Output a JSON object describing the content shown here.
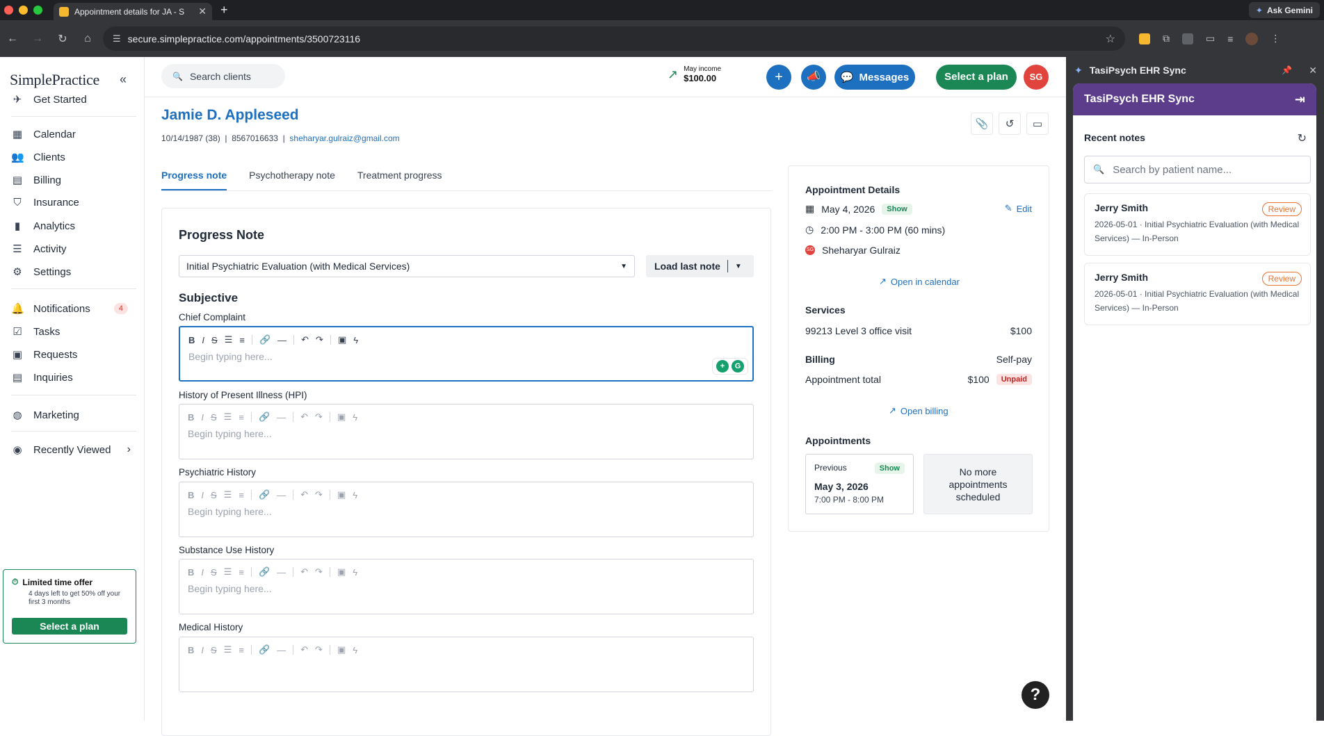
{
  "browser": {
    "tab_title": "Appointment details for JA - S",
    "url": "secure.simplepractice.com/appointments/3500723116",
    "gemini_label": "Ask Gemini"
  },
  "sidebar": {
    "logo": "SimplePractice",
    "items": [
      {
        "label": "Get Started",
        "icon": "rocket-icon"
      },
      {
        "label": "Calendar",
        "icon": "calendar-icon"
      },
      {
        "label": "Clients",
        "icon": "users-icon"
      },
      {
        "label": "Billing",
        "icon": "billing-icon"
      },
      {
        "label": "Insurance",
        "icon": "shield-icon"
      },
      {
        "label": "Analytics",
        "icon": "chart-icon"
      },
      {
        "label": "Activity",
        "icon": "list-icon"
      },
      {
        "label": "Settings",
        "icon": "gear-icon"
      },
      {
        "label": "Notifications",
        "icon": "bell-icon",
        "count": "4"
      },
      {
        "label": "Tasks",
        "icon": "tasks-icon"
      },
      {
        "label": "Requests",
        "icon": "requests-icon"
      },
      {
        "label": "Inquiries",
        "icon": "inquiries-icon"
      },
      {
        "label": "Marketing",
        "icon": "globe-icon"
      },
      {
        "label": "Recently Viewed",
        "icon": "eye-icon"
      }
    ],
    "offer": {
      "title": "Limited time offer",
      "desc": "4 days left to get 50% off your first 3 months",
      "button": "Select a plan"
    }
  },
  "header": {
    "search_placeholder": "Search clients",
    "income_label": "May income",
    "income_value": "$100.00",
    "messages_label": "Messages",
    "plan_label": "Select a plan",
    "avatar_initials": "SG"
  },
  "client": {
    "name": "Jamie D. Appleseed",
    "dob": "10/14/1987 (38)",
    "phone": "8567016633",
    "email": "sheharyar.gulraiz@gmail.com"
  },
  "tabs": [
    "Progress note",
    "Psychotherapy note",
    "Treatment progress"
  ],
  "note": {
    "title": "Progress Note",
    "template": "Initial Psychiatric Evaluation (with Medical Services)",
    "load_label": "Load last note",
    "section": "Subjective",
    "placeholder": "Begin typing here...",
    "fields": [
      "Chief Complaint",
      "History of Present Illness (HPI)",
      "Psychiatric History",
      "Substance Use History",
      "Medical History"
    ]
  },
  "appointment": {
    "heading": "Appointment Details",
    "date": "May 4, 2026",
    "status": "Show",
    "edit_label": "Edit",
    "time": "2:00 PM - 3:00 PM (60 mins)",
    "clinician": "Sheharyar Gulraiz",
    "clinician_initials": "SG",
    "open_calendar": "Open in calendar",
    "services_heading": "Services",
    "service_name": "99213 Level 3 office visit",
    "service_price": "$100",
    "billing_heading": "Billing",
    "billing_type": "Self-pay",
    "total_label": "Appointment total",
    "total_value": "$100",
    "total_status": "Unpaid",
    "open_billing": "Open billing",
    "appointments_heading": "Appointments",
    "previous_label": "Previous",
    "previous_status": "Show",
    "previous_date": "May 3, 2026",
    "previous_time": "7:00 PM - 8:00 PM",
    "no_more": "No more appointments scheduled"
  },
  "extension": {
    "panel_title": "TasiPsych EHR Sync",
    "header_title": "TasiPsych EHR Sync",
    "recent_label": "Recent notes",
    "search_placeholder": "Search by patient name...",
    "notes": [
      {
        "name": "Jerry Smith",
        "status": "Review",
        "desc": "2026-05-01 · Initial Psychiatric Evaluation (with Medical Services) — In-Person"
      },
      {
        "name": "Jerry Smith",
        "status": "Review",
        "desc": "2026-05-01 · Initial Psychiatric Evaluation (with Medical Services) — In-Person"
      }
    ]
  },
  "help_label": "?"
}
